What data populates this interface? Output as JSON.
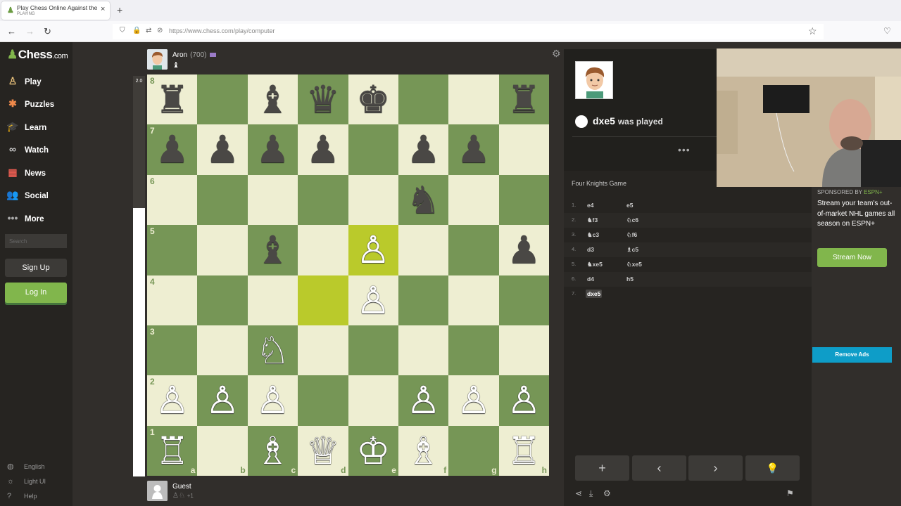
{
  "browser": {
    "tab_title": "Play Chess Online Against the C",
    "tab_status": "PLAYING",
    "new_tab": "+",
    "close": "×",
    "url": "https://www.chess.com/play/computer"
  },
  "sidebar": {
    "logo_main": "Chess",
    "logo_suffix": ".com",
    "items": [
      {
        "label": "Play",
        "icon": "play-icon"
      },
      {
        "label": "Puzzles",
        "icon": "puzzles-icon"
      },
      {
        "label": "Learn",
        "icon": "learn-icon"
      },
      {
        "label": "Watch",
        "icon": "watch-icon"
      },
      {
        "label": "News",
        "icon": "news-icon"
      },
      {
        "label": "Social",
        "icon": "social-icon"
      },
      {
        "label": "More",
        "icon": "more-icon"
      }
    ],
    "search_placeholder": "Search",
    "signup": "Sign Up",
    "login": "Log In",
    "footer": [
      "English",
      "Light UI",
      "Help"
    ]
  },
  "eval": {
    "score": "2.0",
    "white_fraction": 0.67
  },
  "top_player": {
    "name": "Aron",
    "rating": "(700)",
    "captured": "♝"
  },
  "bottom_player": {
    "name": "Guest",
    "captured": "♙♘",
    "advantage": "+1"
  },
  "board": {
    "ranks": [
      "8",
      "7",
      "6",
      "5",
      "4",
      "3",
      "2",
      "1"
    ],
    "files": [
      "a",
      "b",
      "c",
      "d",
      "e",
      "f",
      "g",
      "h"
    ],
    "highlight": [
      "d4",
      "e5"
    ],
    "pieces": [
      [
        "♜",
        "",
        "♝",
        "♛",
        "♚",
        "",
        "",
        "♜"
      ],
      [
        "♟",
        "♟",
        "♟",
        "♟",
        "",
        "♟",
        "♟",
        ""
      ],
      [
        "",
        "",
        "",
        "",
        "",
        "♞",
        "",
        ""
      ],
      [
        "",
        "",
        "♝",
        "",
        "♙",
        "",
        "",
        "♟"
      ],
      [
        "",
        "",
        "",
        "",
        "♙",
        "",
        "",
        ""
      ],
      [
        "",
        "",
        "♘",
        "",
        "",
        "",
        "",
        ""
      ],
      [
        "♙",
        "♙",
        "♙",
        "",
        "",
        "♙",
        "♙",
        "♙"
      ],
      [
        "♖",
        "",
        "♗",
        "♕",
        "♔",
        "♗",
        "",
        "♖"
      ]
    ],
    "colors": [
      [
        "b",
        "",
        "b",
        "b",
        "b",
        "",
        "",
        "b"
      ],
      [
        "b",
        "b",
        "b",
        "b",
        "",
        "b",
        "b",
        ""
      ],
      [
        "",
        "",
        "",
        "",
        "",
        "b",
        "",
        ""
      ],
      [
        "",
        "",
        "b",
        "",
        "w",
        "",
        "",
        "b"
      ],
      [
        "",
        "",
        "",
        "",
        "w",
        "",
        "",
        ""
      ],
      [
        "",
        "",
        "w",
        "",
        "",
        "",
        "",
        ""
      ],
      [
        "w",
        "w",
        "w",
        "",
        "",
        "w",
        "w",
        "w"
      ],
      [
        "w",
        "",
        "w",
        "w",
        "w",
        "w",
        "",
        "w"
      ]
    ]
  },
  "coach": {
    "move": "dxe5",
    "message": "was played",
    "dots": "•••"
  },
  "opening": "Four Knights Game",
  "moves": [
    {
      "num": "1.",
      "white": "e4",
      "black": "e5"
    },
    {
      "num": "2.",
      "white": "♞f3",
      "black": "♘c6"
    },
    {
      "num": "3.",
      "white": "♞c3",
      "black": "♘f6"
    },
    {
      "num": "4.",
      "white": "d3",
      "black": "♗c5"
    },
    {
      "num": "5.",
      "white": "♞xe5",
      "black": "♘xe5"
    },
    {
      "num": "6.",
      "white": "d4",
      "black": "h5"
    },
    {
      "num": "7.",
      "white": "dxe5",
      "black": ""
    }
  ],
  "controls": {
    "add": "+",
    "prev": "‹",
    "next": "›",
    "hint": "💡"
  },
  "ad": {
    "sponsored": "SPONSORED BY ",
    "sponsor": "ESPN+",
    "text": "Stream your team's out-of-market NHL games all season on ESPN+",
    "button": "Stream Now",
    "remove": "Remove Ads"
  }
}
